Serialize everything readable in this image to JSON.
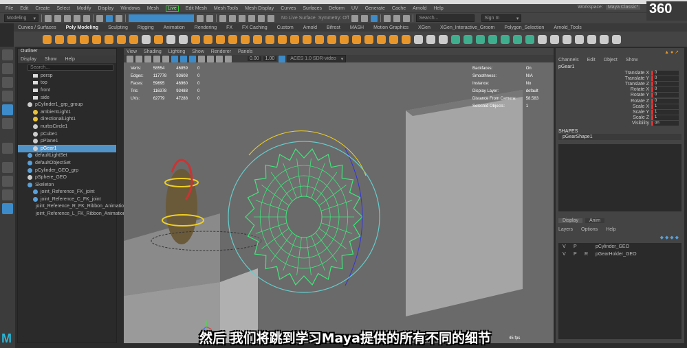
{
  "menubar": [
    "File",
    "Edit",
    "Create",
    "Select",
    "Modify",
    "Display",
    "Windows",
    "Mesh",
    "Edit Mesh",
    "Mesh Tools",
    "Mesh Display",
    "Curves",
    "Surfaces",
    "Deform",
    "UV",
    "Generate",
    "Cache",
    "Arnold",
    "Help"
  ],
  "live_menu": "Live",
  "status": {
    "mode": "Modeling",
    "live_surface": "No Live Surface",
    "symmetry": "Symmetry: Off",
    "workspace_label": "Workspace:",
    "workspace": "Maya Classic*",
    "search_placeholder": "Search...",
    "user": "Sign In"
  },
  "shelf_tabs": [
    "Curves / Surfaces",
    "Poly Modeling",
    "Sculpting",
    "Rigging",
    "Animation",
    "Rendering",
    "FX",
    "FX Caching",
    "Custom",
    "Arnold",
    "Bifrost",
    "MASH",
    "Motion Graphics",
    "XGen",
    "XGen_Interactive_Groom",
    "Polygon_Selection",
    "Arnold_Tools"
  ],
  "active_shelf_tab": "Poly Modeling",
  "outliner": {
    "title": "Outliner",
    "menu": [
      "Display",
      "Show",
      "Help"
    ],
    "search": "Search...",
    "items": [
      {
        "label": "persp",
        "icon": "camera",
        "indent": 1
      },
      {
        "label": "top",
        "icon": "camera",
        "indent": 1
      },
      {
        "label": "front",
        "icon": "camera",
        "indent": 1
      },
      {
        "label": "side",
        "icon": "camera",
        "indent": 1
      },
      {
        "label": "pCylinder1_grp_group",
        "icon": "group",
        "indent": 0
      },
      {
        "label": "ambientLight1",
        "icon": "light",
        "indent": 1
      },
      {
        "label": "directionalLight1",
        "icon": "light",
        "indent": 1
      },
      {
        "label": "nurbsCircle1",
        "icon": "curve",
        "indent": 1
      },
      {
        "label": "pCube1",
        "icon": "curve",
        "indent": 1
      },
      {
        "label": "pPlane1",
        "icon": "mesh",
        "indent": 1
      },
      {
        "label": "pGear1",
        "icon": "mesh",
        "indent": 1,
        "selected": true
      },
      {
        "label": "defaultLightSet",
        "icon": "set",
        "indent": 0
      },
      {
        "label": "defaultObjectSet",
        "icon": "set",
        "indent": 0
      },
      {
        "label": "pCylinder_GEO_grp",
        "icon": "set",
        "indent": 0
      },
      {
        "label": "pSphere_GEO",
        "icon": "mesh",
        "indent": 0
      },
      {
        "label": "Skeleton",
        "icon": "joint",
        "indent": 0
      },
      {
        "label": "joint_Reference_FK_joint",
        "icon": "joint",
        "indent": 1
      },
      {
        "label": "joint_Reference_C_FK_joint",
        "icon": "joint",
        "indent": 1
      },
      {
        "label": "joint_Reference_R_FK_Ribbon_Animation_jnt",
        "icon": "joint",
        "indent": 1
      },
      {
        "label": "joint_Reference_L_FK_Ribbon_Animation_jnt",
        "icon": "joint",
        "indent": 1
      }
    ]
  },
  "viewport": {
    "menu": [
      "View",
      "Shading",
      "Lighting",
      "Show",
      "Renderer",
      "Panels"
    ],
    "hud_left": [
      [
        "Verts:",
        "58554",
        "46859",
        "0"
      ],
      [
        "Edges:",
        "117778",
        "93608",
        "0"
      ],
      [
        "Faces:",
        "59695",
        "46960",
        "0"
      ],
      [
        "Tris:",
        "116378",
        "93488",
        "0"
      ],
      [
        "UVs:",
        "62779",
        "47288",
        "0"
      ]
    ],
    "hud_right": [
      [
        "Backfaces:",
        "On"
      ],
      [
        "Smoothness:",
        "N/A"
      ],
      [
        "Instance:",
        "No"
      ],
      [
        "Display Layer:",
        "default"
      ],
      [
        "Distance From Camera:",
        "58.583"
      ],
      [
        "Selected Objects:",
        "1"
      ]
    ],
    "exposure": "0.00",
    "gamma": "1.00",
    "color_space": "ACES 1.0 SDR-video",
    "fps": "45 fps"
  },
  "channel_box": {
    "menu": [
      "Channels",
      "Edit",
      "Object",
      "Show"
    ],
    "object": "pGear1",
    "attrs": [
      [
        "Translate X",
        "0"
      ],
      [
        "Translate Y",
        "0"
      ],
      [
        "Translate Z",
        "0"
      ],
      [
        "Rotate X",
        "0"
      ],
      [
        "Rotate Y",
        "0"
      ],
      [
        "Rotate Z",
        "0"
      ],
      [
        "Scale X",
        "1"
      ],
      [
        "Scale Y",
        "1"
      ],
      [
        "Scale Z",
        "1"
      ],
      [
        "Visibility",
        "on"
      ]
    ],
    "shapes_label": "SHAPES",
    "shape": "pGearShape1"
  },
  "layers": {
    "tabs": [
      "Display",
      "Anim"
    ],
    "menu": [
      "Layers",
      "Options",
      "Help"
    ],
    "rows": [
      [
        "V",
        "P",
        "",
        "pCylinder_GEO"
      ],
      [
        "V",
        "P",
        "R",
        "pGearHolder_GEO"
      ]
    ]
  },
  "subtitle": "然后 我们将跳到学习Maya提供的所有不同的细节",
  "watermark": "360",
  "colors": {
    "accent": "#5293c7",
    "wire": "#3ee87a",
    "selection_yellow": "#f0d020",
    "shelf_orange": "#e8962a"
  }
}
